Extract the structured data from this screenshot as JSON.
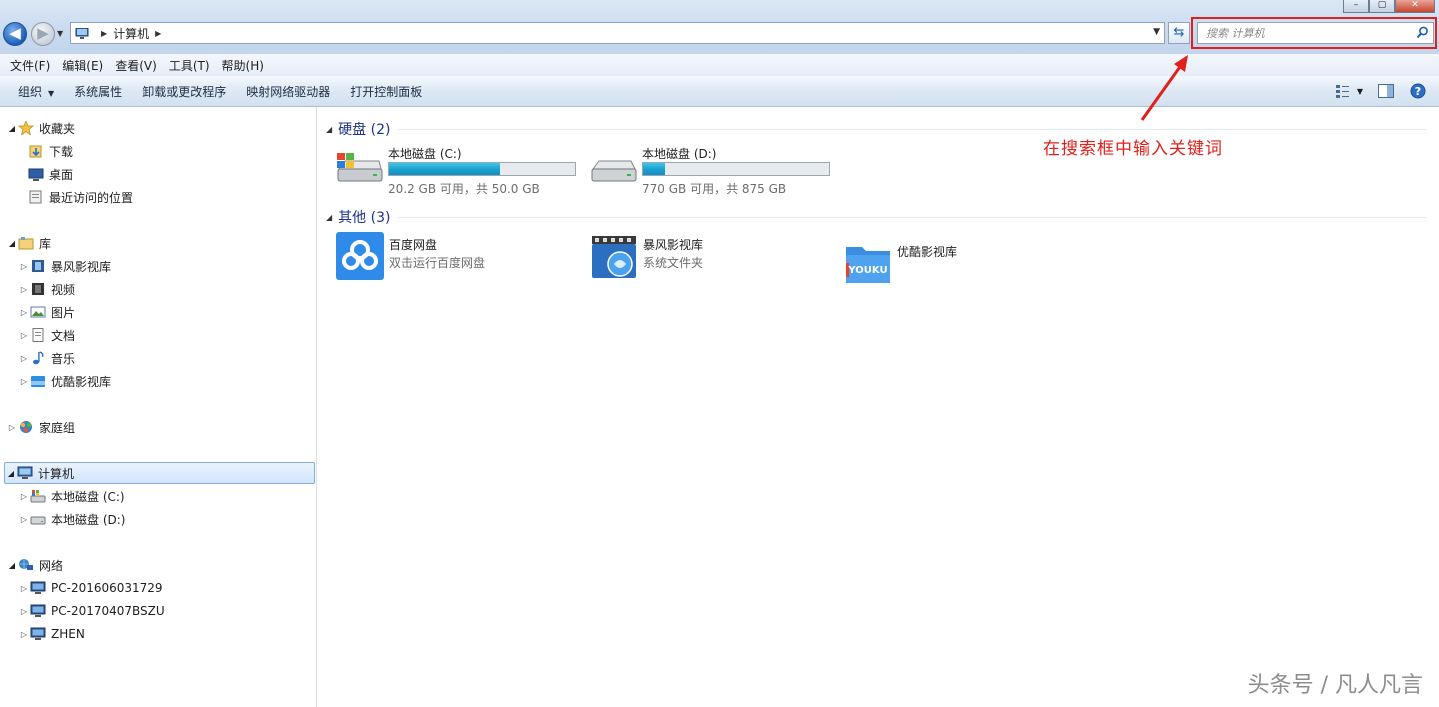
{
  "window": {
    "buttons": [
      "–",
      "▢",
      "✕"
    ]
  },
  "address_bar": {
    "crumbs": [
      "计算机"
    ],
    "search_placeholder": "搜索 计算机"
  },
  "menu": [
    "文件(F)",
    "编辑(E)",
    "查看(V)",
    "工具(T)",
    "帮助(H)"
  ],
  "toolbar": {
    "items": [
      "组织",
      "系统属性",
      "卸载或更改程序",
      "映射网络驱动器",
      "打开控制面板"
    ]
  },
  "nav": {
    "favorites": {
      "label": "收藏夹",
      "children": [
        "下载",
        "桌面",
        "最近访问的位置"
      ]
    },
    "libraries": {
      "label": "库",
      "children": [
        "暴风影视库",
        "视频",
        "图片",
        "文档",
        "音乐",
        "优酷影视库"
      ]
    },
    "homegroup": {
      "label": "家庭组"
    },
    "computer": {
      "label": "计算机",
      "children": [
        "本地磁盘 (C:)",
        "本地磁盘 (D:)"
      ]
    },
    "network": {
      "label": "网络",
      "children": [
        "PC-201606031729",
        "PC-20170407BSZU",
        "ZHEN"
      ]
    }
  },
  "content": {
    "hard_disks": {
      "title": "硬盘 (2)",
      "drives": [
        {
          "name": "本地磁盘 (C:)",
          "size": "20.2 GB 可用，共 50.0 GB",
          "used_fraction": 0.596
        },
        {
          "name": "本地磁盘 (D:)",
          "size": "770 GB 可用，共 875 GB",
          "used_fraction": 0.12
        }
      ]
    },
    "other": {
      "title": "其他 (3)",
      "items": [
        {
          "name": "百度网盘",
          "sub": "双击运行百度网盘"
        },
        {
          "name": "暴风影视库",
          "sub": "系统文件夹"
        },
        {
          "name": "优酷影视库",
          "sub": ""
        }
      ]
    }
  },
  "annotation": "在搜索框中输入关键词",
  "watermark": "头条号 / 凡人凡言",
  "youku_logo": "YOUKU",
  "colors": {
    "annotation": "#e0201a",
    "group_title": "#1e3287",
    "drive_fill": "#1ba2cf"
  }
}
